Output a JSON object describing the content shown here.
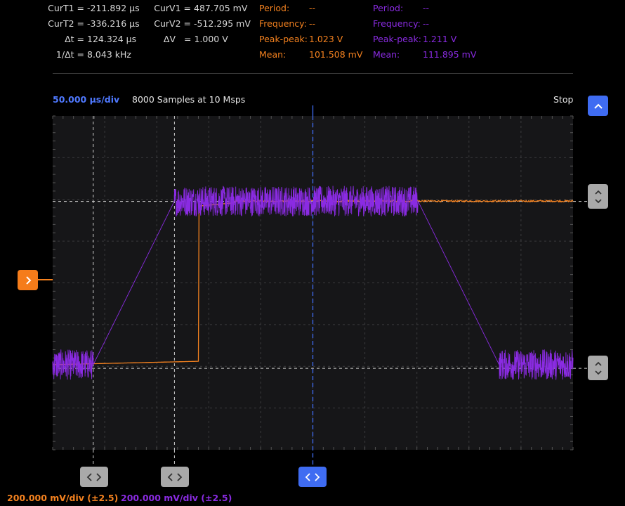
{
  "cursor_readout": [
    {
      "label": "CurT1 =",
      "value": "-211.892 µs"
    },
    {
      "label": "CurT2 =",
      "value": "-336.216 µs"
    },
    {
      "label": "Δt =",
      "value": "124.324 µs"
    },
    {
      "label": "1/Δt =",
      "value": "8.043 kHz"
    }
  ],
  "voltage_readout": [
    {
      "label": "CurV1 =",
      "value": "487.705 mV"
    },
    {
      "label": "CurV2 =",
      "value": "-512.295 mV"
    },
    {
      "label": "ΔV",
      "value": "= 1.000 V"
    }
  ],
  "ch1_measurements": [
    {
      "label": "Period:",
      "value": "--"
    },
    {
      "label": "Frequency:",
      "value": "--"
    },
    {
      "label": "Peak-peak:",
      "value": "1.023 V"
    },
    {
      "label": "Mean:",
      "value": "101.508 mV"
    }
  ],
  "ch2_measurements": [
    {
      "label": "Period:",
      "value": "--"
    },
    {
      "label": "Frequency:",
      "value": "--"
    },
    {
      "label": "Peak-peak:",
      "value": "1.211 V"
    },
    {
      "label": "Mean:",
      "value": "111.895 mV"
    }
  ],
  "header": {
    "timebase": "50.000 µs/div",
    "samples": "8000 Samples at 10 Msps",
    "status": "Stop"
  },
  "footer": {
    "ch1_scale": "200.000 mV/div (±2.5)",
    "ch2_scale": "200.000 mV/div (±2.5)"
  },
  "icons": {
    "collapse": "chevron-up-icon",
    "vertical_cursor": "chevron-up-down-icon",
    "horizontal_cursor": "chevron-left-right-icon",
    "channel_offset": "chevron-right-icon"
  },
  "colors": {
    "ch1": "#f5821f",
    "ch2": "#8a2be2",
    "accent": "#3f6cf2",
    "grid_bg": "#161618"
  },
  "chart_data": {
    "type": "line",
    "x_unit": "µs",
    "y_unit": "V",
    "xlim": [
      -500,
      0
    ],
    "ylim": [
      -1.0,
      1.0
    ],
    "grid": true,
    "divisions": {
      "x": 10,
      "y": 8
    },
    "series": [
      {
        "channel": 1,
        "color": "#f5821f",
        "x": [
          -500,
          -360,
          -360,
          -325,
          -325,
          0
        ],
        "y": [
          -0.49,
          -0.47,
          0.46,
          0.48,
          0.49,
          0.49
        ],
        "noise_amplitude": 0.005
      },
      {
        "channel": 2,
        "color": "#8a2be2",
        "x": [
          -500,
          -461,
          -383,
          -149,
          -71,
          0
        ],
        "y": [
          -0.49,
          -0.49,
          0.49,
          0.49,
          -0.49,
          -0.49
        ],
        "noise_amplitude": 0.09
      }
    ],
    "cursors": {
      "time": [
        -461,
        -383
      ],
      "voltage": [
        0.4877,
        -0.5123
      ],
      "trigger_time": -250,
      "ch1_offset": 0.0
    }
  }
}
